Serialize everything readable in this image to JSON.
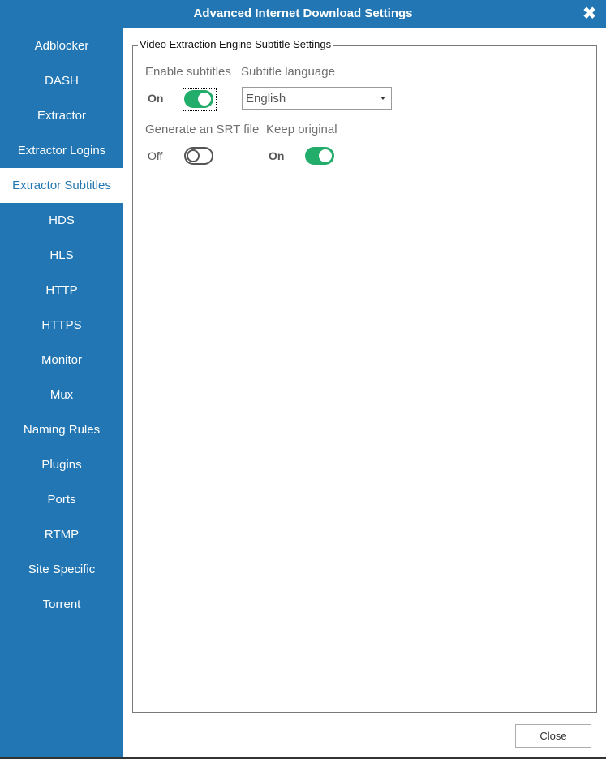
{
  "window": {
    "title": "Advanced Internet Download Settings",
    "close_icon": "close-x-icon"
  },
  "sidebar": {
    "active_index": 4,
    "items": [
      {
        "label": "Adblocker"
      },
      {
        "label": "DASH"
      },
      {
        "label": "Extractor"
      },
      {
        "label": "Extractor Logins"
      },
      {
        "label": "Extractor Subtitles"
      },
      {
        "label": "HDS"
      },
      {
        "label": "HLS"
      },
      {
        "label": "HTTP"
      },
      {
        "label": "HTTPS"
      },
      {
        "label": "Monitor"
      },
      {
        "label": "Mux"
      },
      {
        "label": "Naming Rules"
      },
      {
        "label": "Plugins"
      },
      {
        "label": "Ports"
      },
      {
        "label": "RTMP"
      },
      {
        "label": "Site Specific"
      },
      {
        "label": "Torrent"
      }
    ]
  },
  "group": {
    "title": "Video Extraction Engine Subtitle Settings",
    "enable_subtitles": {
      "label": "Enable subtitles",
      "state_text": "On",
      "value": true
    },
    "subtitle_language": {
      "label": "Subtitle language",
      "value": "English"
    },
    "generate_srt": {
      "label": "Generate an SRT file",
      "state_text": "Off",
      "value": false
    },
    "keep_original": {
      "label": "Keep original",
      "state_text": "On",
      "value": true
    }
  },
  "footer": {
    "close_label": "Close"
  },
  "colors": {
    "accent": "#2176b3",
    "toggle_on": "#22ad6b"
  }
}
